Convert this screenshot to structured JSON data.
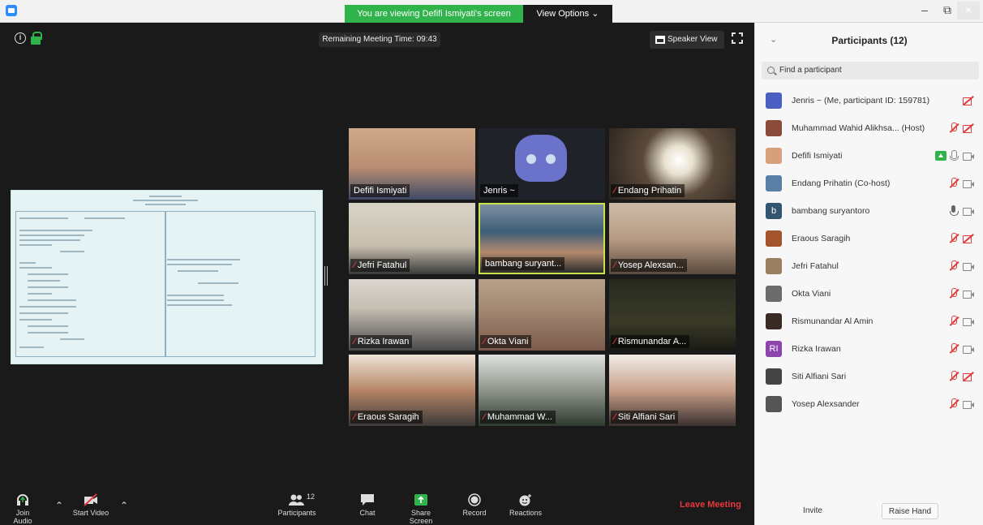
{
  "titlebar": {
    "share_banner": "You are viewing Defifi Ismiyati's screen",
    "view_options": "View Options ⌄",
    "minimize": "–",
    "restore": "⧉",
    "close": "×"
  },
  "meeting": {
    "remaining_time": "Remaining Meeting Time: 09:43",
    "speaker_view": "Speaker View"
  },
  "tiles": [
    {
      "name": "Defifi Ismiyati",
      "muted": false
    },
    {
      "name": "Jenris ~",
      "muted": false
    },
    {
      "name": "Endang Prihatin",
      "muted": true
    },
    {
      "name": "Jefri Fatahul",
      "muted": true
    },
    {
      "name": "bambang suryant...",
      "muted": false
    },
    {
      "name": "Yosep Alexsan...",
      "muted": true
    },
    {
      "name": "Rizka Irawan",
      "muted": true
    },
    {
      "name": "Okta Viani",
      "muted": true
    },
    {
      "name": "Rismunandar A...",
      "muted": true
    },
    {
      "name": "Eraous Saragih",
      "muted": true
    },
    {
      "name": "Muhammad W...",
      "muted": true
    },
    {
      "name": "Siti Alfiani Sari",
      "muted": true
    }
  ],
  "toolbar": {
    "join_audio": "Join Audio",
    "start_video": "Start Video",
    "participants": "Participants",
    "participants_count": "12",
    "chat": "Chat",
    "share_screen": "Share Screen",
    "record": "Record",
    "reactions": "Reactions",
    "leave": "Leave Meeting"
  },
  "panel": {
    "title": "Participants (12)",
    "search_placeholder": "Find a participant",
    "participants": [
      {
        "name": "Jenris ~ (Me, participant ID: 159781)",
        "avatar": "",
        "avatar_color": "#4a5fc1",
        "mic": "none",
        "cam": "off"
      },
      {
        "name": "Muhammad Wahid Alikhsa... (Host)",
        "avatar": "",
        "avatar_color": "#8b4b3a",
        "mic": "off",
        "cam": "off"
      },
      {
        "name": "Defifi Ismiyati",
        "avatar": "",
        "avatar_color": "#d8a07a",
        "mic": "on",
        "cam": "on",
        "sharing": true
      },
      {
        "name": "Endang Prihatin (Co-host)",
        "avatar": "",
        "avatar_color": "#5a7fa6",
        "mic": "off",
        "cam": "on"
      },
      {
        "name": "bambang suryantoro",
        "avatar": "b",
        "avatar_color": "#33556e",
        "mic": "grey",
        "cam": "on"
      },
      {
        "name": "Eraous Saragih",
        "avatar": "",
        "avatar_color": "#a4542d",
        "mic": "off",
        "cam": "off"
      },
      {
        "name": "Jefri Fatahul",
        "avatar": "",
        "avatar_color": "#9b7d5f",
        "mic": "off",
        "cam": "on"
      },
      {
        "name": "Okta Viani",
        "avatar": "",
        "avatar_color": "#6c6c6c",
        "mic": "off",
        "cam": "on"
      },
      {
        "name": "Rismunandar Al Amin",
        "avatar": "",
        "avatar_color": "#3a2a26",
        "mic": "off",
        "cam": "on"
      },
      {
        "name": "Rizka Irawan",
        "avatar": "RI",
        "avatar_color": "#8e44ad",
        "mic": "off",
        "cam": "on"
      },
      {
        "name": "Siti Alfiani Sari",
        "avatar": "",
        "avatar_color": "#444444",
        "mic": "off",
        "cam": "off"
      },
      {
        "name": "Yosep Alexsander",
        "avatar": "",
        "avatar_color": "#555555",
        "mic": "off",
        "cam": "on"
      }
    ],
    "invite": "Invite",
    "raise_hand": "Raise Hand"
  }
}
